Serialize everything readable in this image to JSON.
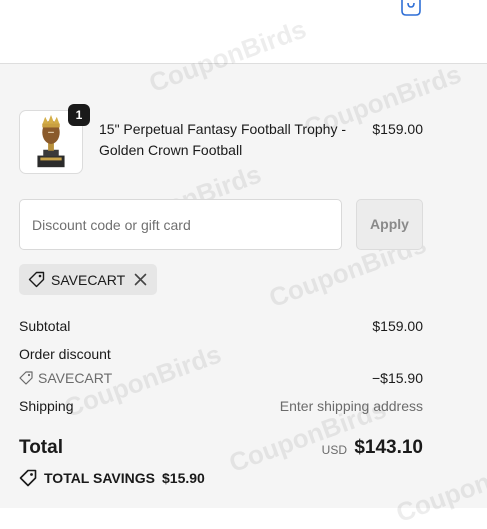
{
  "header": {
    "cart_icon": "shopping-bag-icon"
  },
  "line_item": {
    "quantity": "1",
    "title_line1": "15\" Perpetual Fantasy Football Trophy -",
    "title_line2": "Golden Crown Football",
    "price": "$159.00",
    "image_icon": "trophy-image"
  },
  "discount": {
    "placeholder": "Discount code or gift card",
    "apply_label": "Apply",
    "applied_code": "SAVECART"
  },
  "summary": {
    "subtotal_label": "Subtotal",
    "subtotal_value": "$159.00",
    "order_discount_label": "Order discount",
    "discount_code": "SAVECART",
    "discount_value": "−$15.90",
    "shipping_label": "Shipping",
    "shipping_value": "Enter shipping address",
    "total_label": "Total",
    "currency": "USD",
    "total_value": "$143.10",
    "savings_label": "TOTAL SAVINGS",
    "savings_value": "$15.90"
  },
  "watermark_text": "CouponBirds",
  "colors": {
    "summary_bg": "#f5f5f5",
    "badge_bg": "#1a1a1a",
    "chip_bg": "#e6e6e6",
    "apply_bg": "#ececec"
  }
}
